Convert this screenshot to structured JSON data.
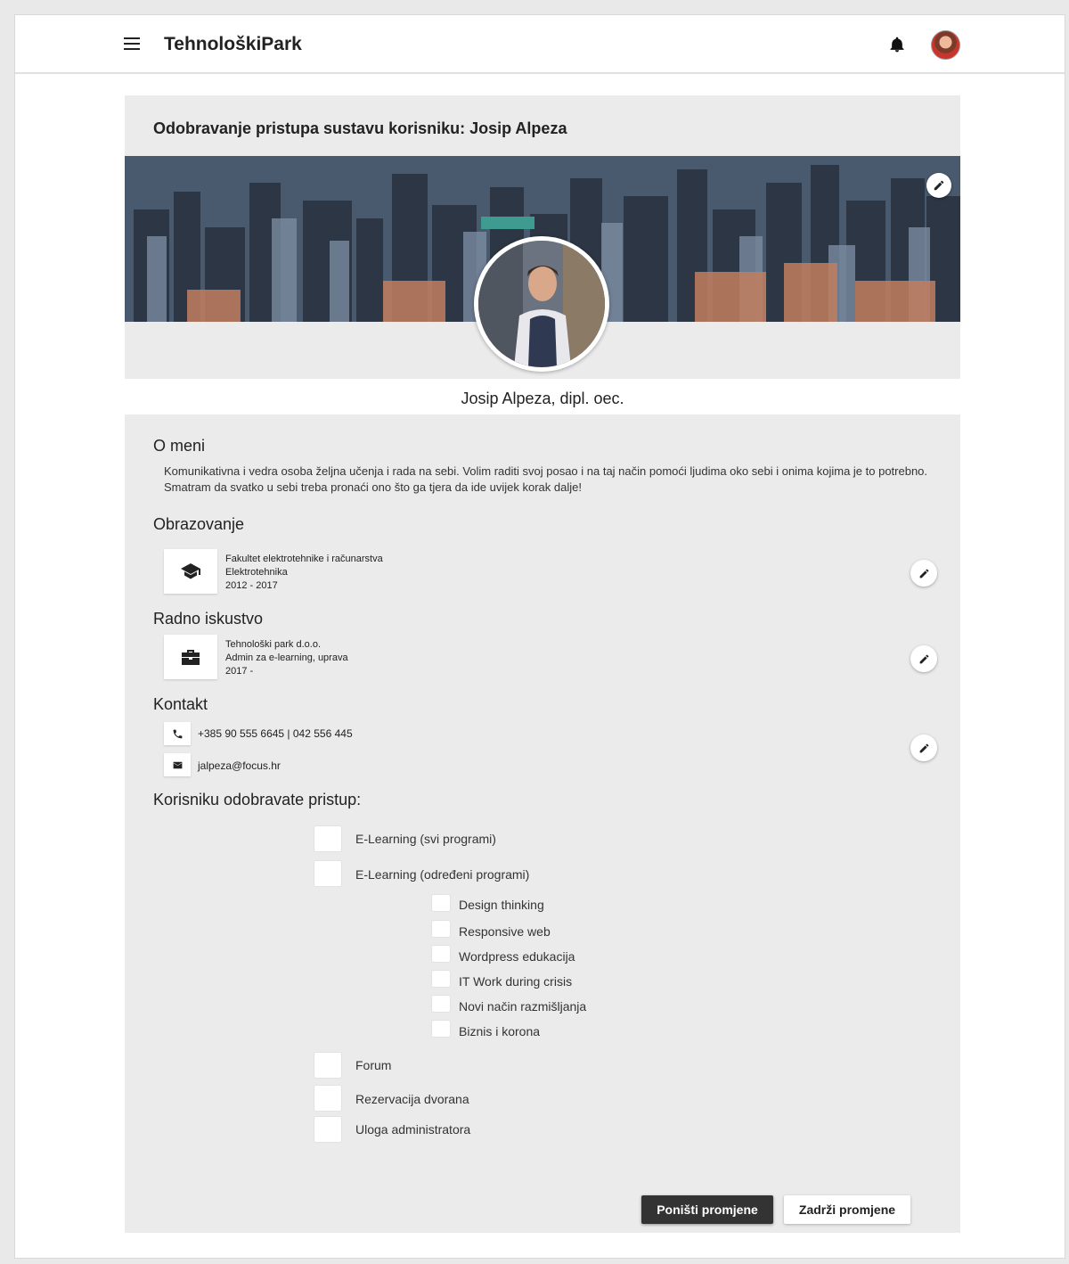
{
  "app": {
    "title": "TehnološkiPark"
  },
  "card": {
    "title": "Odobravanje pristupa sustavu korisniku: Josip Alpeza",
    "profile_name": "Josip Alpeza, dipl. oec."
  },
  "about": {
    "title": "O meni",
    "text": "Komunikativna i vedra osoba željna učenja i rada na sebi. Volim raditi svoj posao i na taj način pomoći ljudima oko sebi i onima kojima je to potrebno. Smatram da svatko u sebi treba pronaći ono što ga tjera da ide uvijek korak dalje!"
  },
  "education": {
    "title": "Obrazovanje",
    "institution": "Fakultet elektrotehnike i računarstva",
    "field": "Elektrotehnika",
    "years": "2012 - 2017"
  },
  "experience": {
    "title": "Radno iskustvo",
    "company": "Tehnološki park d.o.o.",
    "role": "Admin za e-learning, uprava",
    "years": "2017 -"
  },
  "contact": {
    "title": "Kontakt",
    "phone": "+385 90 555 6645  |  042 556 445",
    "email": "jalpeza@focus.hr"
  },
  "access": {
    "title": "Korisniku odobravate pristup:",
    "options": [
      "E-Learning (svi programi)",
      "E-Learning (određeni programi)",
      "Forum",
      "Rezervacija dvorana",
      "Uloga administratora"
    ],
    "programs": [
      "Design thinking",
      "Responsive web",
      "Wordpress edukacija",
      "IT Work during crisis",
      "Novi način razmišljanja",
      "Biznis i korona"
    ]
  },
  "buttons": {
    "reset": "Poništi promjene",
    "keep": "Zadrži promjene"
  },
  "colors": {
    "accent_dark": "#333333",
    "panel": "#ebebeb"
  },
  "icons": [
    "menu-icon",
    "bell-icon",
    "pencil-icon",
    "graduation-cap-icon",
    "briefcase-icon",
    "phone-icon",
    "mail-icon"
  ]
}
